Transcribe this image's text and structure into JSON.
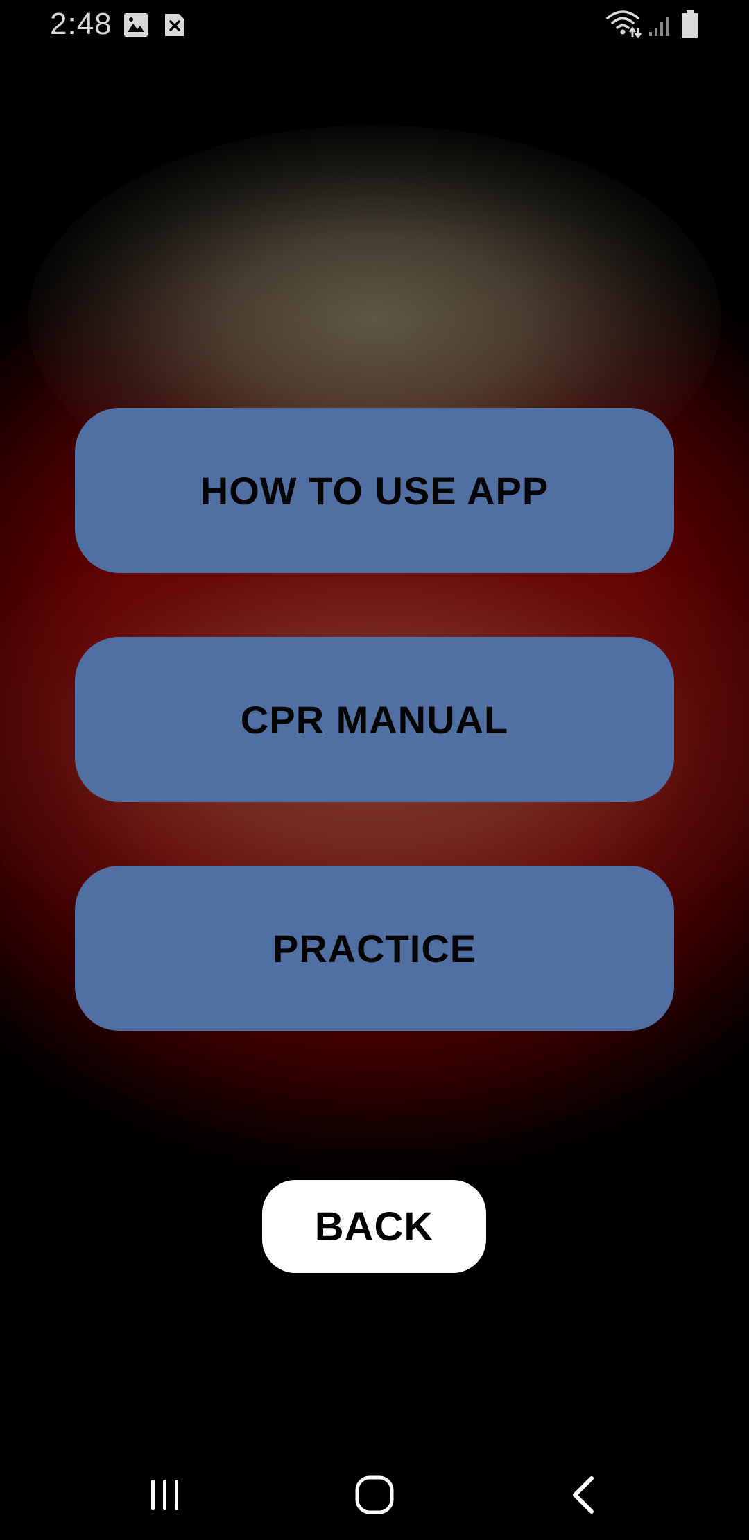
{
  "status_bar": {
    "time": "2:48",
    "icons": [
      "image-notification-icon",
      "close-notification-icon",
      "wifi-icon",
      "signal-icon",
      "battery-icon"
    ]
  },
  "menu": {
    "how_to_use_label": "HOW TO USE APP",
    "cpr_manual_label": "CPR MANUAL",
    "practice_label": "PRACTICE"
  },
  "back_label": "BACK",
  "nav_bar": {
    "icons": [
      "recent-apps-icon",
      "home-icon",
      "back-icon"
    ]
  },
  "colors": {
    "button_fill": "#5070a3",
    "background": "#000000",
    "glow_red": "#780000",
    "back_button_fill": "#ffffff"
  }
}
